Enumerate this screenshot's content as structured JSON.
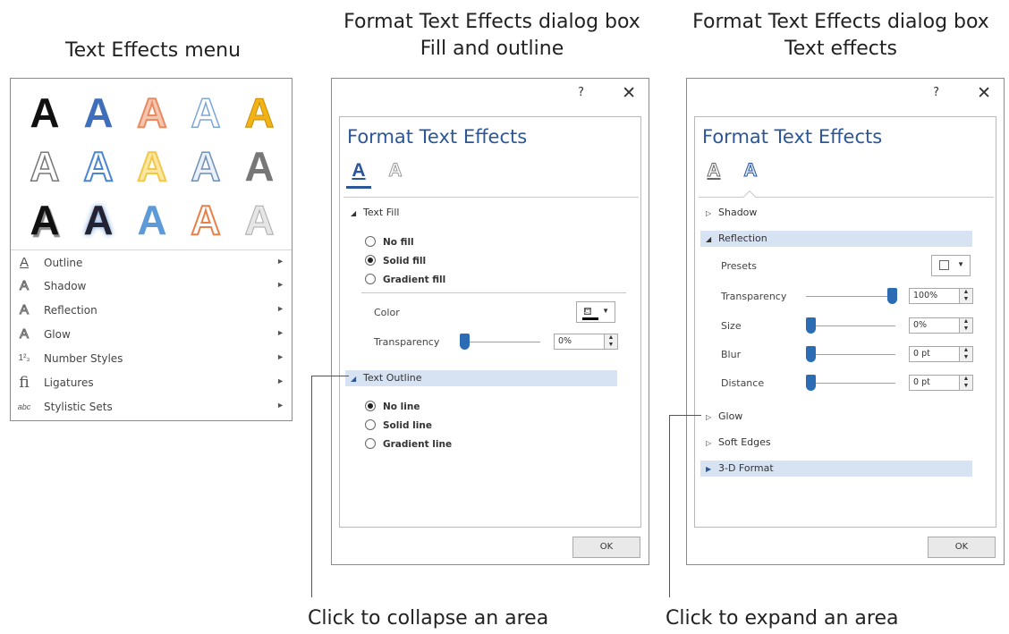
{
  "captions": {
    "menu": "Text Effects menu",
    "dialog1": [
      "Format Text Effects dialog box",
      "Fill and outline"
    ],
    "dialog2": [
      "Format Text Effects dialog box",
      "Text effects"
    ],
    "callout1": "Click to collapse an area",
    "callout2": "Click to expand an area"
  },
  "menu": {
    "gallery_letter": "A",
    "items": [
      {
        "label": "Outline",
        "icon": "outline-a-icon",
        "glyph": "A"
      },
      {
        "label": "Shadow",
        "icon": "shadow-a-icon",
        "glyph": "A"
      },
      {
        "label": "Reflection",
        "icon": "reflection-a-icon",
        "glyph": "A"
      },
      {
        "label": "Glow",
        "icon": "glow-a-icon",
        "glyph": "A"
      },
      {
        "label": "Number Styles",
        "icon": "number-styles-icon",
        "glyph": "1²₃"
      },
      {
        "label": "Ligatures",
        "icon": "ligatures-icon",
        "glyph": "fi"
      },
      {
        "label": "Stylistic Sets",
        "icon": "stylistic-sets-icon",
        "glyph": "abc"
      }
    ],
    "submenu_arrow": "►"
  },
  "dialog1": {
    "help": "?",
    "close": "✕",
    "title": "Format Text Effects",
    "tab_glyph": "A",
    "text_fill": "Text Fill",
    "fill_options": [
      "No fill",
      "Solid fill",
      "Gradient fill"
    ],
    "color_label": "Color",
    "transparency_label": "Transparency",
    "transparency_value": "0%",
    "text_outline": "Text Outline",
    "line_options": [
      "No line",
      "Solid line",
      "Gradient line"
    ],
    "ok": "OK"
  },
  "dialog2": {
    "help": "?",
    "close": "✕",
    "title": "Format Text Effects",
    "tab_glyph": "A",
    "sections": [
      "Shadow",
      "Reflection",
      "Glow",
      "Soft Edges",
      "3-D Format"
    ],
    "presets_label": "Presets",
    "transparency_label": "Transparency",
    "transparency_value": "100%",
    "size_label": "Size",
    "size_value": "0%",
    "blur_label": "Blur",
    "blur_value": "0 pt",
    "distance_label": "Distance",
    "distance_value": "0 pt",
    "ok": "OK"
  },
  "colors": {
    "accent_blue": "#2b579a",
    "highlight": "#d7e3f3",
    "slider_thumb": "#2b6cb5"
  }
}
